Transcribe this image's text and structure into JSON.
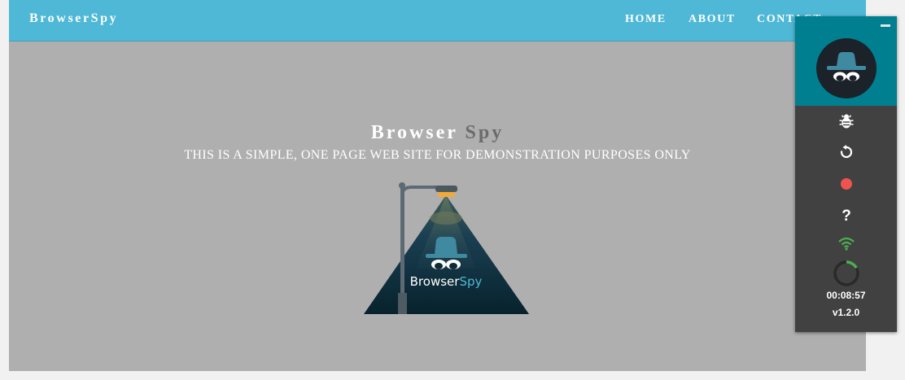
{
  "navbar": {
    "brand": "BrowserSpy",
    "links": [
      {
        "label": "HOME"
      },
      {
        "label": "ABOUT"
      },
      {
        "label": "CONTACT"
      }
    ],
    "background_color": "#4fb8d6"
  },
  "hero": {
    "title_main": "Browser",
    "title_accent": "Spy",
    "subtitle": "THIS IS A SIMPLE, ONE PAGE WEB SITE FOR DEMONSTRATION PURPOSES ONLY",
    "logo_text_main": "Browser",
    "logo_text_accent": "Spy",
    "background_color": "#b0afaf"
  },
  "extension": {
    "icons": [
      "spy-avatar-icon",
      "bug-icon",
      "reload-icon",
      "record-icon",
      "help-icon",
      "wifi-icon",
      "progress-ring-icon"
    ],
    "help_label": "?",
    "timer": "00:08:57",
    "version": "v1.2.0",
    "header_color": "#007f90",
    "panel_color": "#414141",
    "record_color": "#ef5350",
    "wifi_color": "#4caf50",
    "progress_fraction": 0.17
  }
}
